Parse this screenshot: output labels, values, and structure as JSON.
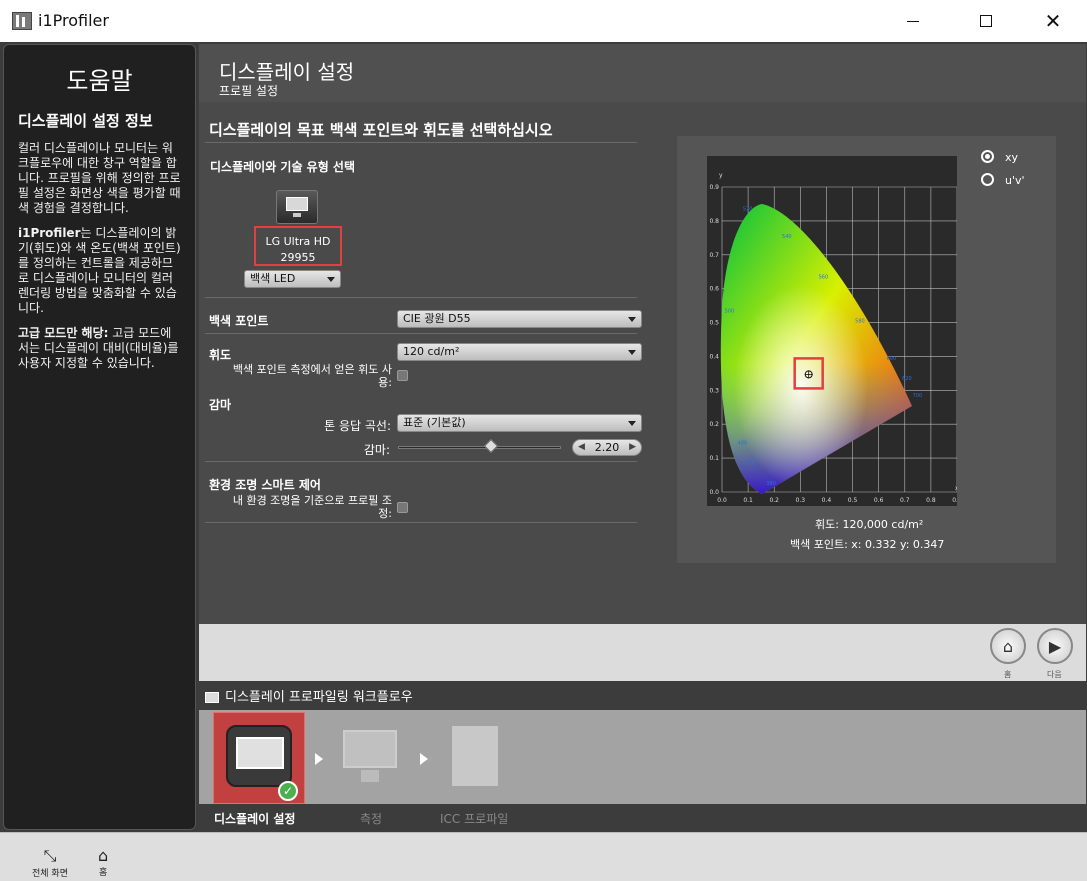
{
  "window": {
    "title": "i1Profiler"
  },
  "help": {
    "title": "도움말",
    "heading": "디스플레이 설정 정보",
    "para1": "컬러 디스플레이나 모니터는 워크플로우에 대한 창구 역할을 합니다. 프로필을 위해 정의한 프로필 설정은 화면상 색을 평가할 때 색 경험을 결정합니다.",
    "para2_bold": "i1Profiler",
    "para2": "는 디스플레이의 밝기(휘도)와 색 온도(백색 포인트)를 정의하는 컨트롤을 제공하므로 디스플레이나 모니터의 컬러 렌더링 방법을 맞춤화할 수 있습니다.",
    "para3_bold": "고급 모드만 해당:",
    "para3": " 고급 모드에서는 디스플레이 대비(대비율)를 사용자 지정할 수 있습니다."
  },
  "header": {
    "title": "디스플레이 설정",
    "subtitle": "프로필 설정"
  },
  "main": {
    "section_title": "디스플레이의 목표 백색 포인트와 휘도를 선택하십시오",
    "display_type_label": "디스플레이와 기술 유형 선택",
    "monitor_name": "LG Ultra HD",
    "monitor_id": "29955",
    "tech_select": "백색 LED",
    "whitepoint_label": "백색 포인트",
    "whitepoint_value": "CIE 광원 D55",
    "luminance_label": "휘도",
    "luminance_value": "120 cd/m²",
    "measure_ambient_label": "백색 포인트 측정에서 얻은 휘도 사용:",
    "gamma_section": "감마",
    "tone_curve_label": "톤 응답 곡선:",
    "tone_curve_value": "표준 (기본값)",
    "gamma_label": "감마:",
    "gamma_value": "2.20",
    "gamma_slider_fraction": 0.57,
    "ambient_section": "환경 조명 스마트 제어",
    "ambient_check_label": "내 환경 조명을 기준으로 프로필 조정:"
  },
  "chart": {
    "radio_xy": "xy",
    "radio_uv": "u'v'",
    "luminance_text": "휘도: 120,000 cd/m²",
    "whitepoint_text": "백색 포인트: x: 0.332  y: 0.347",
    "y_axis": "y",
    "x_axis": "x"
  },
  "chart_data": {
    "type": "scatter",
    "title": "",
    "xlabel": "x",
    "ylabel": "y",
    "xlim": [
      0,
      0.9
    ],
    "ylim": [
      0,
      0.9
    ],
    "x_ticks": [
      "0.0",
      "0.1",
      "0.2",
      "0.3",
      "0.4",
      "0.5",
      "0.6",
      "0.7",
      "0.8",
      "0.9"
    ],
    "y_ticks": [
      "0.0",
      "0.1",
      "0.2",
      "0.3",
      "0.4",
      "0.5",
      "0.6",
      "0.7",
      "0.8",
      "0.9"
    ],
    "wavelength_labels": [
      {
        "label": "520",
        "x": 0.08,
        "y": 0.83
      },
      {
        "label": "540",
        "x": 0.23,
        "y": 0.75
      },
      {
        "label": "560",
        "x": 0.37,
        "y": 0.63
      },
      {
        "label": "580",
        "x": 0.51,
        "y": 0.5
      },
      {
        "label": "600",
        "x": 0.63,
        "y": 0.39
      },
      {
        "label": "620",
        "x": 0.69,
        "y": 0.33
      },
      {
        "label": "700",
        "x": 0.73,
        "y": 0.28
      },
      {
        "label": "500",
        "x": 0.01,
        "y": 0.53
      },
      {
        "label": "480",
        "x": 0.06,
        "y": 0.14
      },
      {
        "label": "470",
        "x": 0.09,
        "y": 0.08
      },
      {
        "label": "380",
        "x": 0.17,
        "y": 0.02
      }
    ],
    "series": [
      {
        "name": "",
        "points": [
          [
            0.332,
            0.347
          ]
        ]
      }
    ],
    "grid": true
  },
  "nav": {
    "home_label": "홈",
    "next_label": "다음"
  },
  "workflow": {
    "title": "디스플레이 프로파일링 워크플로우",
    "steps": [
      "디스플레이 설정",
      "측정",
      "ICC 프로파일"
    ]
  },
  "bottom": {
    "fullscreen_label": "전체 화면",
    "home_label": "홈"
  },
  "colors": {
    "accent_red": "#e04040",
    "panel_dark": "#202020"
  }
}
